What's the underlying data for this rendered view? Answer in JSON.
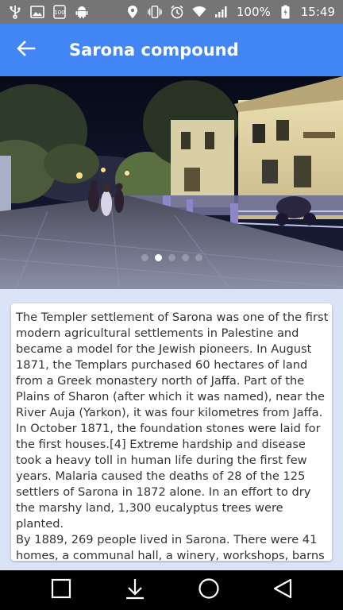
{
  "status_bar": {
    "icons_left": [
      "usb-icon",
      "image-icon",
      "notification-100-icon",
      "android-icon"
    ],
    "icons_right": [
      "location-icon",
      "vibrate-icon",
      "alarm-icon",
      "wifi-icon",
      "signal-icon",
      "battery-icon"
    ],
    "battery_percent": "100%",
    "time": "15:49"
  },
  "app_bar": {
    "title": "Sarona compound",
    "back_icon": "arrow-back-icon",
    "color": "#4285f4"
  },
  "gallery": {
    "image_description": "street-night-photo",
    "page_count": 5,
    "active_index": 1
  },
  "article": {
    "text": "The Templer settlement of Sarona was one of the first modern agricultural settlements in Palestine and became a model for the Jewish pioneers. In August 1871, the Templars purchased 60 hectares of land from a Greek monastery north of Jaffa. Part of the Plains of Sharon (after which it was named), near the River Auja (Yarkon), it was four kilometres from Jaffa. In October 1871, the foundation stones were laid for the first houses.[4] Extreme hardship and disease took a heavy toll in human life during the first few years. Malaria caused the deaths of 28 of the 125 settlers of Sarona in 1872 alone. In an effort to dry the marshy land, 1,300 eucalyptus trees were planted.\nBy 1889, 269 people lived in Sarona. There were 41 homes, a communal hall, a winery, workshops, barns"
  },
  "nav_bar": {
    "buttons": [
      "recents-icon",
      "download-icon",
      "home-icon",
      "back-icon"
    ]
  }
}
